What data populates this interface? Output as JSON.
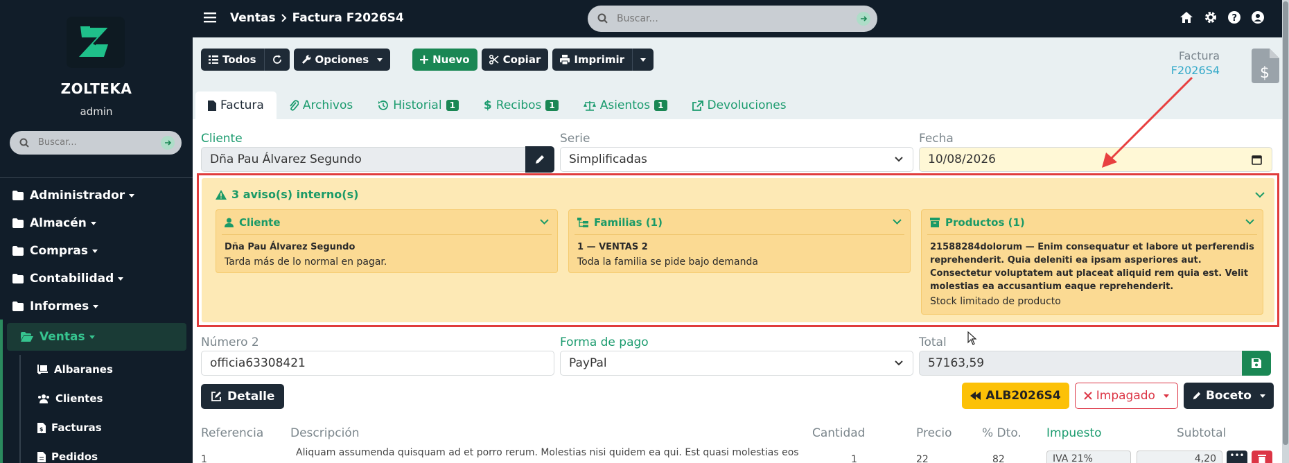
{
  "sidebar": {
    "brand": "ZOLTEKA",
    "user": "admin",
    "search_placeholder": "Buscar...",
    "menu": [
      {
        "label": "Administrador"
      },
      {
        "label": "Almacén"
      },
      {
        "label": "Compras"
      },
      {
        "label": "Contabilidad"
      },
      {
        "label": "Informes"
      },
      {
        "label": "Ventas"
      }
    ],
    "submenu": [
      {
        "label": "Albaranes"
      },
      {
        "label": "Clientes"
      },
      {
        "label": "Facturas"
      },
      {
        "label": "Pedidos"
      }
    ]
  },
  "topbar": {
    "crumb_section": "Ventas",
    "crumb_page": "Factura F2026S4",
    "search_placeholder": "Buscar..."
  },
  "toolbar": {
    "todos": "Todos",
    "opciones": "Opciones",
    "nuevo": "Nuevo",
    "copiar": "Copiar",
    "imprimir": "Imprimir"
  },
  "doc": {
    "label": "Factura",
    "code": "F2026S4"
  },
  "tabs": [
    {
      "label": "Factura",
      "badge": ""
    },
    {
      "label": "Archivos",
      "badge": ""
    },
    {
      "label": "Historial",
      "badge": "1"
    },
    {
      "label": "Recibos",
      "badge": "1"
    },
    {
      "label": "Asientos",
      "badge": "1"
    },
    {
      "label": "Devoluciones",
      "badge": ""
    }
  ],
  "form": {
    "cliente_label": "Cliente",
    "cliente_value": "Dña Pau Álvarez Segundo",
    "serie_label": "Serie",
    "serie_value": "Simplificadas",
    "fecha_label": "Fecha",
    "fecha_value": "10/08/2026",
    "numero2_label": "Número 2",
    "numero2_value": "officia63308421",
    "pago_label": "Forma de pago",
    "pago_value": "PayPal",
    "total_label": "Total",
    "total_value": "57163,59"
  },
  "warnings": {
    "title": "3 aviso(s) interno(s)",
    "cards": [
      {
        "title": "Cliente",
        "strong": "Dña Pau Álvarez Segundo",
        "text": "Tarda más de lo normal en pagar."
      },
      {
        "title": "Familias (1)",
        "strong": "1 — VENTAS 2",
        "text": "Toda la familia se pide bajo demanda"
      },
      {
        "title": "Productos (1)",
        "strong": "21588284dolorum — Enim consequatur et labore ut perferendis reprehenderit. Quia deleniti ea ipsam asperiores aut. Consectetur voluptatem aut placeat aliquid rem quia est. Velit molestias ea accusantium eaque reprehenderit.",
        "text": "Stock limitado de producto"
      }
    ]
  },
  "actions": {
    "detalle": "Detalle",
    "albaran": "ALB2026S4",
    "impagado": "Impagado",
    "boceto": "Boceto"
  },
  "lines": {
    "headers": {
      "referencia": "Referencia",
      "descripcion": "Descripción",
      "cantidad": "Cantidad",
      "precio": "Precio",
      "dto": "% Dto.",
      "impuesto": "Impuesto",
      "subtotal": "Subtotal"
    },
    "row": {
      "ref": "1",
      "desc": "Aliquam assumenda quisquam ad et porro rerum. Molestias nisi quidem ea qui. Est quasi molestias eos",
      "cantidad": "1",
      "precio": "22",
      "dto": "82",
      "impuesto": "IVA 21%",
      "subtotal": "4,20"
    }
  },
  "colors": {
    "accent": "#1a8754",
    "sidebar": "#111d29",
    "warning_bg": "#fde9b5",
    "highlight": "#e03c3c"
  }
}
